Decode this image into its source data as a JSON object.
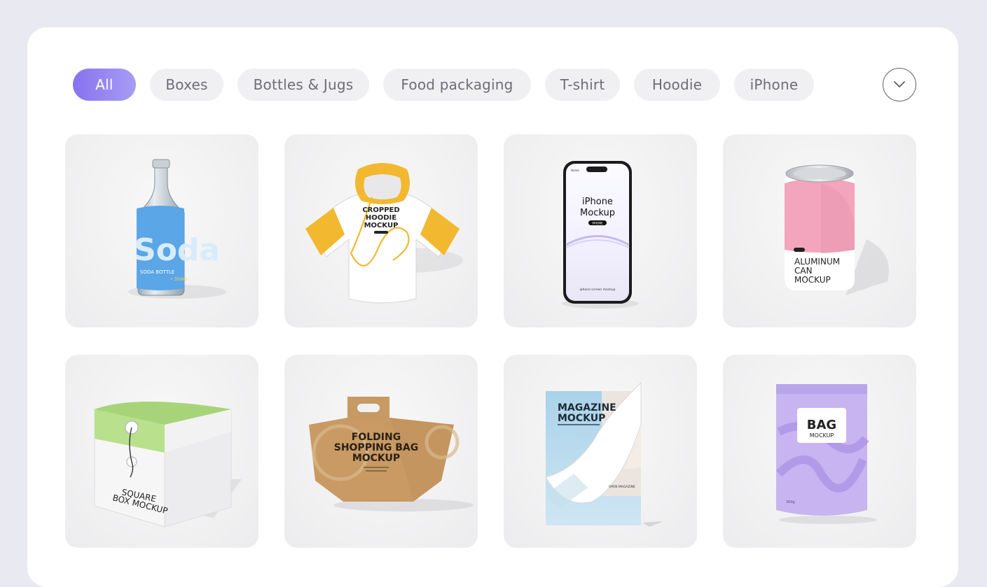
{
  "filters": {
    "chips": [
      {
        "label": "All",
        "active": true
      },
      {
        "label": "Boxes",
        "active": false
      },
      {
        "label": "Bottles & Jugs",
        "active": false
      },
      {
        "label": "Food packaging",
        "active": false
      },
      {
        "label": "T-shirt",
        "active": false
      },
      {
        "label": "Hoodie",
        "active": false
      },
      {
        "label": "iPhone",
        "active": false
      }
    ],
    "expand_icon": "chevron-down-icon"
  },
  "colors": {
    "background": "#e8e9f1",
    "panel": "#ffffff",
    "chip": "#f0f0f3",
    "chip_text": "#6d6d77",
    "accent_start": "#8772ef",
    "accent_end": "#a89cf5"
  },
  "mockups": [
    {
      "name": "soda-bottle",
      "lines": [
        "Soda",
        "SODA BOTTLE",
        "• 350ML"
      ]
    },
    {
      "name": "cropped-hoodie",
      "lines": [
        "CROPPED",
        "HOODIE",
        "MOCKUP"
      ]
    },
    {
      "name": "iphone",
      "lines": [
        "Home",
        "iPhone",
        "Mockup",
        "IPHONE",
        "iphone screen mockup"
      ]
    },
    {
      "name": "aluminum-can",
      "lines": [
        "ALUMINUM",
        "CAN",
        "MOCKUP"
      ]
    },
    {
      "name": "square-box",
      "lines": [
        "SQUARE",
        "BOX MOCKUP"
      ]
    },
    {
      "name": "folding-shopping-bag",
      "lines": [
        "FOLDING",
        "SHOPPING BAG",
        "MOCKUP"
      ]
    },
    {
      "name": "magazine",
      "lines": [
        "MAGAZINE",
        "MOCKUP",
        "OPEN MAGAZINE"
      ]
    },
    {
      "name": "pouch-bag",
      "lines": [
        "BAG",
        "MOCKUP",
        "300g"
      ]
    }
  ]
}
